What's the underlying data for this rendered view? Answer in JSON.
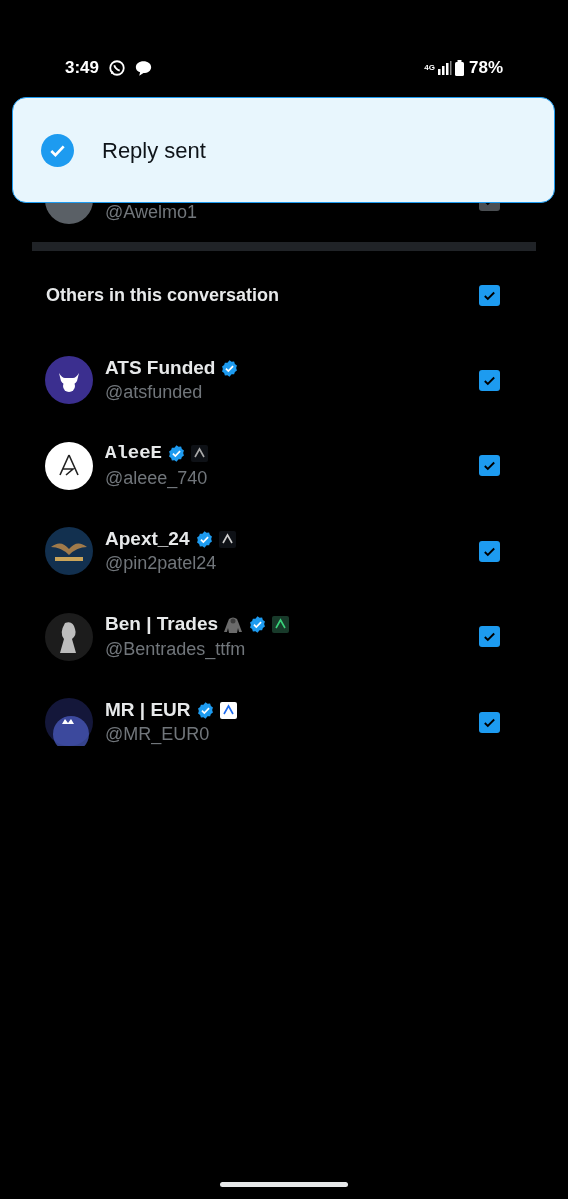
{
  "status_bar": {
    "time": "3:49",
    "network": "4G",
    "battery": "78%"
  },
  "toast": {
    "message": "Reply sent"
  },
  "covered_row": {
    "handle": "@Awelmo1",
    "checked": true,
    "disabled": true
  },
  "section": {
    "title": "Others in this conversation",
    "checked": true
  },
  "people": [
    {
      "name": "ATS Funded",
      "handle": "@atsfunded",
      "verified": true,
      "mono": false,
      "emoji": false,
      "affiliate": false,
      "checked": true
    },
    {
      "name": "AleeE",
      "handle": "@aleee_740",
      "verified": true,
      "mono": true,
      "emoji": false,
      "affiliate": true,
      "checked": true
    },
    {
      "name": "Apext_24",
      "handle": "@pin2patel24",
      "verified": true,
      "mono": false,
      "emoji": false,
      "affiliate": true,
      "checked": true
    },
    {
      "name": "Ben | Trades",
      "handle": "@Bentrades_ttfm",
      "verified": true,
      "mono": false,
      "emoji": true,
      "affiliate": true,
      "checked": true
    },
    {
      "name": "MR | EUR",
      "handle": "@MR_EUR0",
      "verified": true,
      "mono": false,
      "emoji": false,
      "affiliate": true,
      "checked": true
    }
  ]
}
